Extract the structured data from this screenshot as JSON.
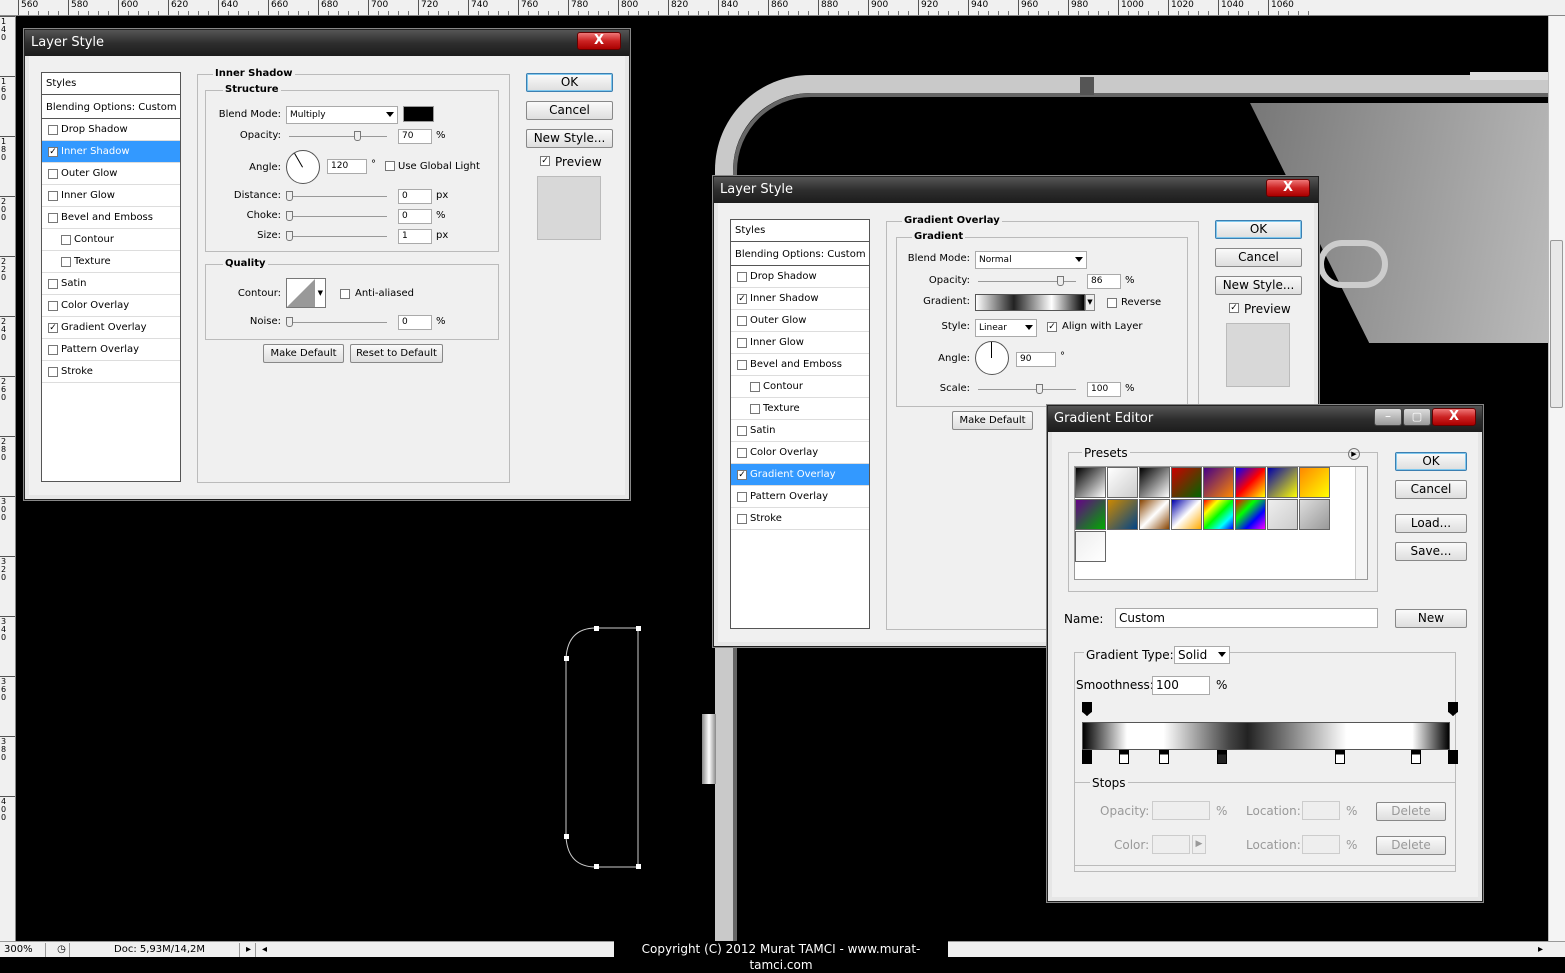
{
  "ruler": {
    "h_labels": [
      "560",
      "580",
      "600",
      "620",
      "640",
      "660",
      "680",
      "700",
      "720",
      "740",
      "760",
      "780",
      "800",
      "820",
      "840",
      "860",
      "880",
      "900",
      "920",
      "940",
      "960",
      "980",
      "1000",
      "1020",
      "1040",
      "1060"
    ],
    "v_labels": [
      "140",
      "160",
      "180",
      "200",
      "220",
      "240",
      "260",
      "280",
      "300",
      "320",
      "340",
      "360",
      "380",
      "400"
    ]
  },
  "status": {
    "zoom": "300%",
    "doc": "Doc: 5,93M/14,2M",
    "copyright": "Copyright (C) 2012 Murat TAMCI - www.murat-tamci.com"
  },
  "dialog1": {
    "title": "Layer Style",
    "close": "X",
    "styles_header": "Styles",
    "blending": "Blending Options: Custom",
    "items": [
      {
        "label": "Drop Shadow",
        "checked": "",
        "indent": false
      },
      {
        "label": "Inner Shadow",
        "checked": "✓",
        "indent": false,
        "selected": true
      },
      {
        "label": "Outer Glow",
        "checked": "",
        "indent": false
      },
      {
        "label": "Inner Glow",
        "checked": "",
        "indent": false
      },
      {
        "label": "Bevel and Emboss",
        "checked": "",
        "indent": false
      },
      {
        "label": "Contour",
        "checked": "",
        "indent": true
      },
      {
        "label": "Texture",
        "checked": "",
        "indent": true
      },
      {
        "label": "Satin",
        "checked": "",
        "indent": false
      },
      {
        "label": "Color Overlay",
        "checked": "",
        "indent": false
      },
      {
        "label": "Gradient Overlay",
        "checked": "✓",
        "indent": false
      },
      {
        "label": "Pattern Overlay",
        "checked": "",
        "indent": false
      },
      {
        "label": "Stroke",
        "checked": "",
        "indent": false
      }
    ],
    "section": "Inner Shadow",
    "structure": "Structure",
    "blend_mode_label": "Blend Mode:",
    "blend_mode": "Multiply",
    "opacity_label": "Opacity:",
    "opacity": "70",
    "pct": "%",
    "angle_label": "Angle:",
    "angle": "120",
    "deg": "°",
    "global_light": "Use Global Light",
    "distance_label": "Distance:",
    "distance": "0",
    "px": "px",
    "choke_label": "Choke:",
    "choke": "0",
    "size_label": "Size:",
    "size": "1",
    "quality": "Quality",
    "contour_label": "Contour:",
    "anti_aliased": "Anti-aliased",
    "noise_label": "Noise:",
    "noise": "0",
    "make_default": "Make Default",
    "reset_default": "Reset to Default",
    "ok": "OK",
    "cancel": "Cancel",
    "new_style": "New Style...",
    "preview": "Preview",
    "preview_checked": "✓",
    "shadow_color": "#000000"
  },
  "dialog2": {
    "title": "Layer Style",
    "close": "X",
    "styles_header": "Styles",
    "blending": "Blending Options: Custom",
    "items": [
      {
        "label": "Drop Shadow",
        "checked": "",
        "indent": false
      },
      {
        "label": "Inner Shadow",
        "checked": "✓",
        "indent": false
      },
      {
        "label": "Outer Glow",
        "checked": "",
        "indent": false
      },
      {
        "label": "Inner Glow",
        "checked": "",
        "indent": false
      },
      {
        "label": "Bevel and Emboss",
        "checked": "",
        "indent": false
      },
      {
        "label": "Contour",
        "checked": "",
        "indent": true
      },
      {
        "label": "Texture",
        "checked": "",
        "indent": true
      },
      {
        "label": "Satin",
        "checked": "",
        "indent": false
      },
      {
        "label": "Color Overlay",
        "checked": "",
        "indent": false
      },
      {
        "label": "Gradient Overlay",
        "checked": "✓",
        "indent": false,
        "selected": true
      },
      {
        "label": "Pattern Overlay",
        "checked": "",
        "indent": false
      },
      {
        "label": "Stroke",
        "checked": "",
        "indent": false
      }
    ],
    "section": "Gradient Overlay",
    "gradient": "Gradient",
    "blend_mode_label": "Blend Mode:",
    "blend_mode": "Normal",
    "opacity_label": "Opacity:",
    "opacity": "86",
    "pct": "%",
    "gradient_label": "Gradient:",
    "reverse": "Reverse",
    "style_label": "Style:",
    "style": "Linear",
    "align": "Align with Layer",
    "align_checked": "✓",
    "angle_label": "Angle:",
    "angle": "90",
    "deg": "°",
    "scale_label": "Scale:",
    "scale": "100",
    "make_default": "Make Default",
    "ok": "OK",
    "cancel": "Cancel",
    "new_style": "New Style...",
    "preview": "Preview",
    "preview_checked": "✓"
  },
  "gradient_editor": {
    "title": "Gradient Editor",
    "presets": "Presets",
    "ok": "OK",
    "cancel": "Cancel",
    "load": "Load...",
    "save": "Save...",
    "name_label": "Name:",
    "name": "Custom",
    "new": "New",
    "type_label": "Gradient Type:",
    "type": "Solid",
    "smooth_label": "Smoothness:",
    "smooth": "100",
    "pct": "%",
    "stops": "Stops",
    "opacity_label": "Opacity:",
    "location_label": "Location:",
    "color_label": "Color:",
    "delete": "Delete",
    "preset_colors": [
      "#000 #fff",
      "#fff #ccc",
      "#000 #fff",
      "#c00 #060",
      "#408 #f80",
      "#00f #f00 #ff0",
      "#00a #ff0",
      "#f80 #ff0",
      "#608 #0a0",
      "#c80 #048",
      "#840 #fff #840",
      "#00a #fff #fa0",
      "#f00 #ff0 #0f0 #0ff #00f",
      "#f00 #0f0 #00f #f0f",
      "#eee #ccc",
      "#ddd #999",
      "#eee #fff"
    ]
  }
}
